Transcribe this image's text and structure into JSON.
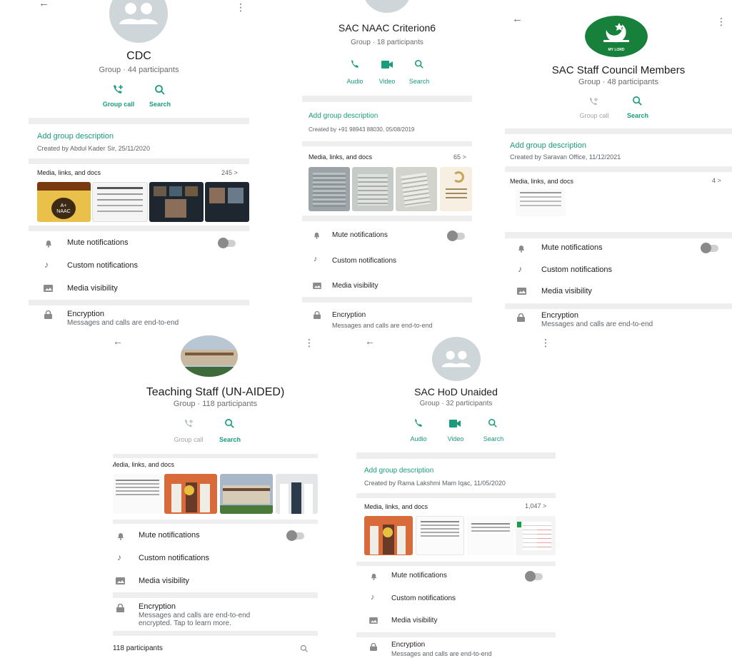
{
  "colors": {
    "accent": "#1a9c7b",
    "avatar_bg": "#cfd6da",
    "section_bg": "#ffffff",
    "page_bg": "#eeeeee"
  },
  "panels": {
    "cdc": {
      "title": "CDC",
      "subtitle": "Group · 44 participants",
      "btn_call": "Group call",
      "btn_search": "Search",
      "add_desc": "Add group description",
      "created": "Created by Abdul Kader Sir, 25/11/2020",
      "media_label": "Media, links, and docs",
      "media_count": "245 >",
      "mute": "Mute notifications",
      "custom": "Custom notifications",
      "visibility": "Media visibility",
      "encryption": "Encryption",
      "enc_sub": "Messages and calls are end-to-end",
      "thumb_caption": "A+ NAAC"
    },
    "naac": {
      "title": "SAC NAAC Criterion6",
      "subtitle": "Group · 18 participants",
      "btn_audio": "Audio",
      "btn_video": "Video",
      "btn_search": "Search",
      "add_desc": "Add group description",
      "created": "Created by +91 98943 88030, 05/08/2019",
      "media_label": "Media, links, and docs",
      "media_count": "65 >",
      "mute": "Mute notifications",
      "custom": "Custom notifications",
      "visibility": "Media visibility",
      "encryption": "Encryption",
      "enc_sub": "Messages and calls are end-to-end"
    },
    "council": {
      "title": "SAC Staff Council Members",
      "subtitle": "Group · 48 participants",
      "btn_call": "Group call",
      "btn_search": "Search",
      "add_desc": "Add group description",
      "created": "Created by Saravan Office, 11/12/2021",
      "media_label": "Media, links, and docs",
      "media_count": "4 >",
      "mute": "Mute notifications",
      "custom": "Custom notifications",
      "visibility": "Media visibility",
      "encryption": "Encryption",
      "enc_sub": "Messages and calls are end-to-end",
      "logo_text": "MY LORD"
    },
    "teaching": {
      "title": "Teaching Staff (UN-AIDED)",
      "subtitle": "Group · 118 participants",
      "btn_call": "Group call",
      "btn_search": "Search",
      "media_label": "Media, links, and docs",
      "mute": "Mute notifications",
      "custom": "Custom notifications",
      "visibility": "Media visibility",
      "encryption": "Encryption",
      "enc_sub1": "Messages and calls are end-to-end",
      "enc_sub2": "encrypted. Tap to learn more.",
      "participants": "118 participants"
    },
    "hod": {
      "title": "SAC HoD Unaided",
      "subtitle": "Group · 32 participants",
      "btn_audio": "Audio",
      "btn_video": "Video",
      "btn_search": "Search",
      "add_desc": "Add group description",
      "created": "Created by Rama Lakshmi Mam Iqac, 11/05/2020",
      "media_label": "Media, links, and docs",
      "media_count": "1,047 >",
      "mute": "Mute notifications",
      "custom": "Custom notifications",
      "visibility": "Media visibility",
      "encryption": "Encryption",
      "enc_sub": "Messages and calls are end-to-end"
    }
  }
}
